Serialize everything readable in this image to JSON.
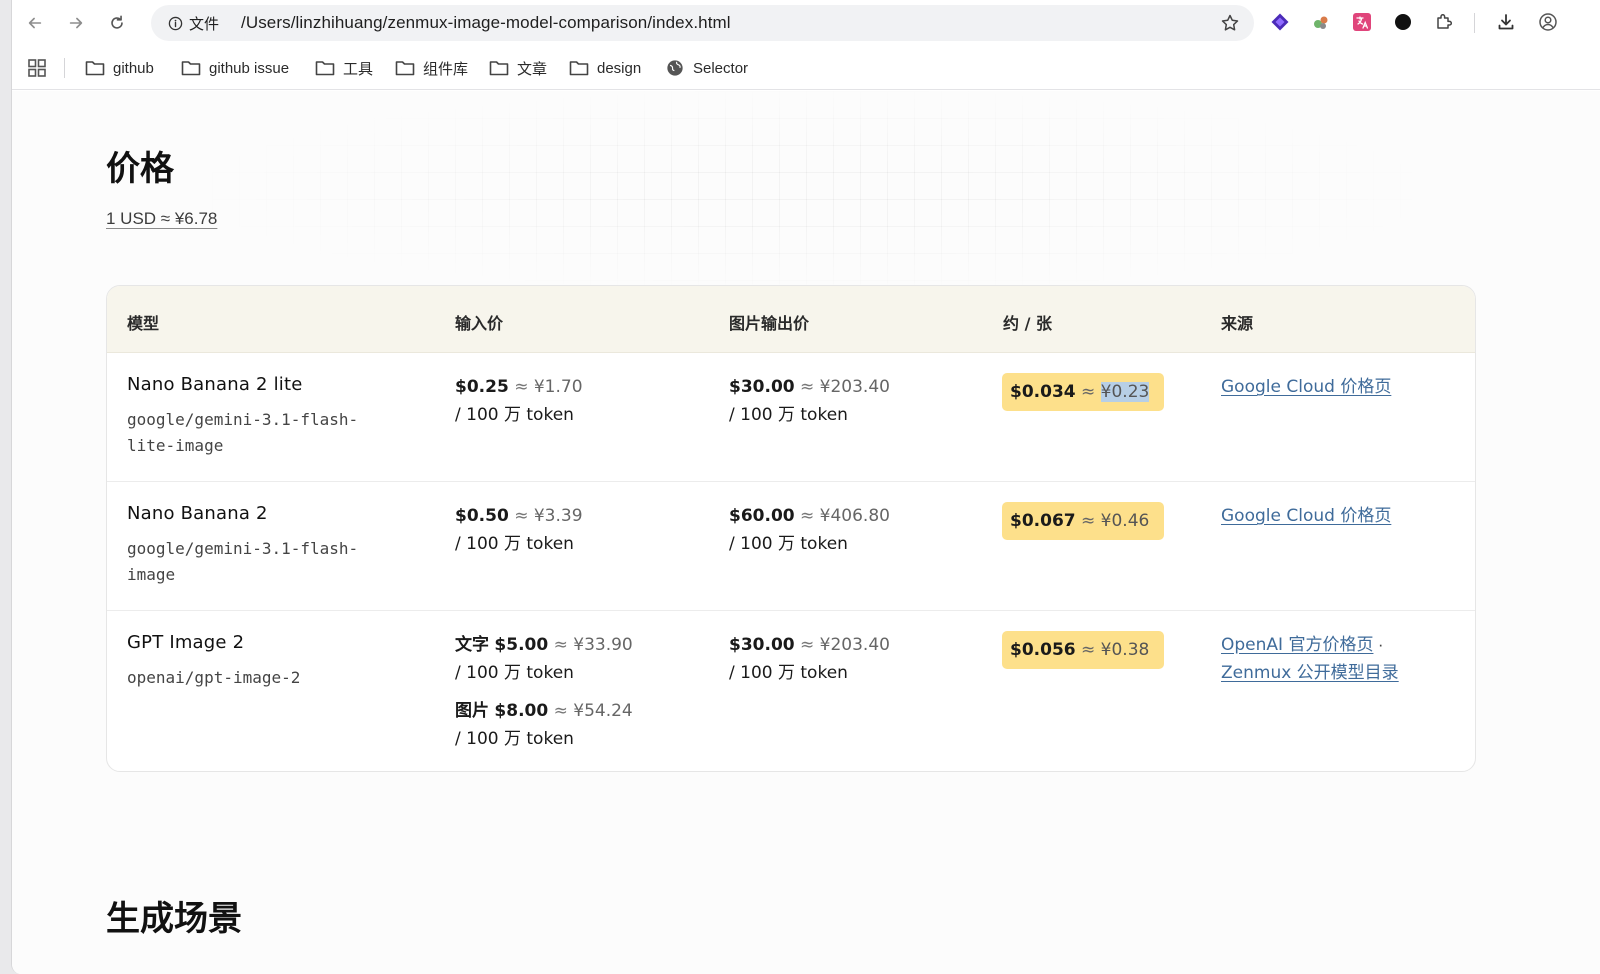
{
  "browser": {
    "site_info_label": "文件",
    "url": "/Users/linzhihuang/zenmux-image-model-comparison/index.html",
    "bookmarks": [
      {
        "label": "github"
      },
      {
        "label": "github issue"
      },
      {
        "label": "工具"
      },
      {
        "label": "组件库"
      },
      {
        "label": "文章"
      },
      {
        "label": "design"
      },
      {
        "label": "Selector"
      }
    ]
  },
  "colors": {
    "badge": "#fde08b",
    "link": "#3f6b9a",
    "header_bg": "#f7f5ec"
  },
  "page": {
    "price_heading": "价格",
    "exchange_rate": "1 USD ≈ ¥6.78",
    "scenes_heading": "生成场景"
  },
  "table": {
    "headers": [
      "模型",
      "输入价",
      "图片输出价",
      "约 / 张",
      "来源"
    ],
    "approx_sign": "≈",
    "unit": "/ 100 万 token",
    "rows": [
      {
        "model_name": "Nano Banana 2 lite",
        "model_id": "google/gemini-3.1-flash-lite-image",
        "input": [
          {
            "label": "",
            "usd": "$0.25",
            "cny": "¥1.70"
          }
        ],
        "output": {
          "usd": "$30.00",
          "cny": "¥203.40"
        },
        "per_image": {
          "usd": "$0.034",
          "cny": "¥0.23"
        },
        "sources": [
          "Google Cloud 价格页"
        ]
      },
      {
        "model_name": "Nano Banana 2",
        "model_id": "google/gemini-3.1-flash-image",
        "input": [
          {
            "label": "",
            "usd": "$0.50",
            "cny": "¥3.39"
          }
        ],
        "output": {
          "usd": "$60.00",
          "cny": "¥406.80"
        },
        "per_image": {
          "usd": "$0.067",
          "cny": "¥0.46"
        },
        "sources": [
          "Google Cloud 价格页"
        ]
      },
      {
        "model_name": "GPT Image 2",
        "model_id": "openai/gpt-image-2",
        "input": [
          {
            "label": "文字",
            "usd": "$5.00",
            "cny": "¥33.90"
          },
          {
            "label": "图片",
            "usd": "$8.00",
            "cny": "¥54.24"
          }
        ],
        "output": {
          "usd": "$30.00",
          "cny": "¥203.40"
        },
        "per_image": {
          "usd": "$0.056",
          "cny": "¥0.38"
        },
        "sources": [
          "OpenAI 官方价格页",
          "Zenmux 公开模型目录"
        ],
        "source_separator": "·"
      }
    ]
  }
}
